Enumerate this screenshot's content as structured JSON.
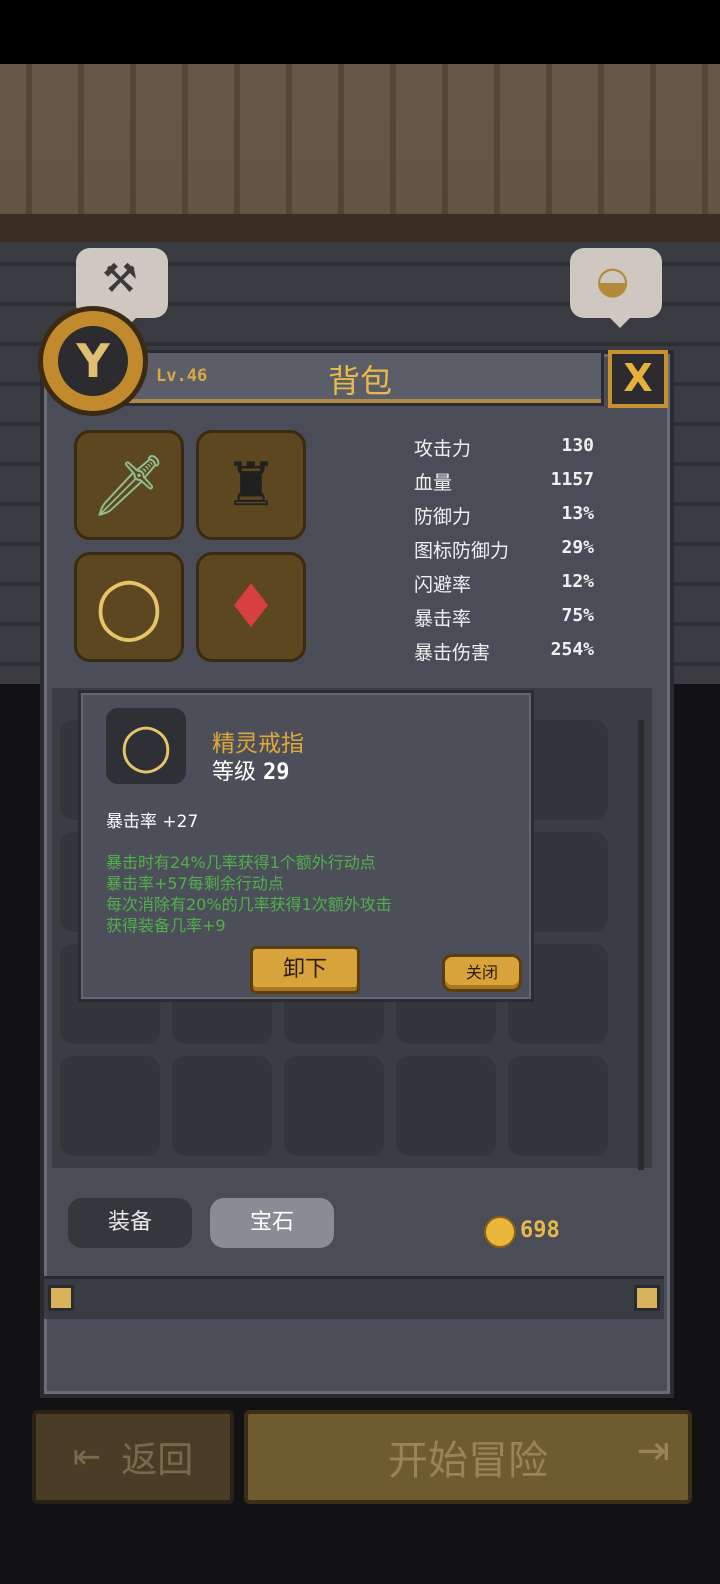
{
  "header": {
    "level": "Lv.46",
    "title": "背包",
    "close": "X"
  },
  "stats": [
    {
      "label": "攻击力",
      "value": "130"
    },
    {
      "label": "血量",
      "value": "1157"
    },
    {
      "label": "防御力",
      "value": "13%"
    },
    {
      "label": "图标防御力",
      "value": "29%"
    },
    {
      "label": "闪避率",
      "value": "12%"
    },
    {
      "label": "暴击率",
      "value": "75%"
    },
    {
      "label": "暴击伤害",
      "value": "254%"
    }
  ],
  "popup": {
    "name": "精灵戒指",
    "level_label": "等级",
    "level_value": "29",
    "primary_stat": "暴击率 +27",
    "effects": [
      "暴击时有24%几率获得1个额外行动点",
      "暴击率+57每剩余行动点",
      "每次消除有20%的几率获得1次额外攻击",
      "获得装备几率+9"
    ],
    "unequip": "卸下",
    "close": "关闭"
  },
  "tabs": {
    "equipment": "装备",
    "gems": "宝石"
  },
  "gold": "698",
  "footer": {
    "back": "返回",
    "start": "开始冒险"
  },
  "icons": {
    "helmet": "helmet-icon",
    "sword": "sword-icon",
    "armor": "armor-icon",
    "ring": "ring-icon",
    "amulet": "amulet-icon"
  }
}
